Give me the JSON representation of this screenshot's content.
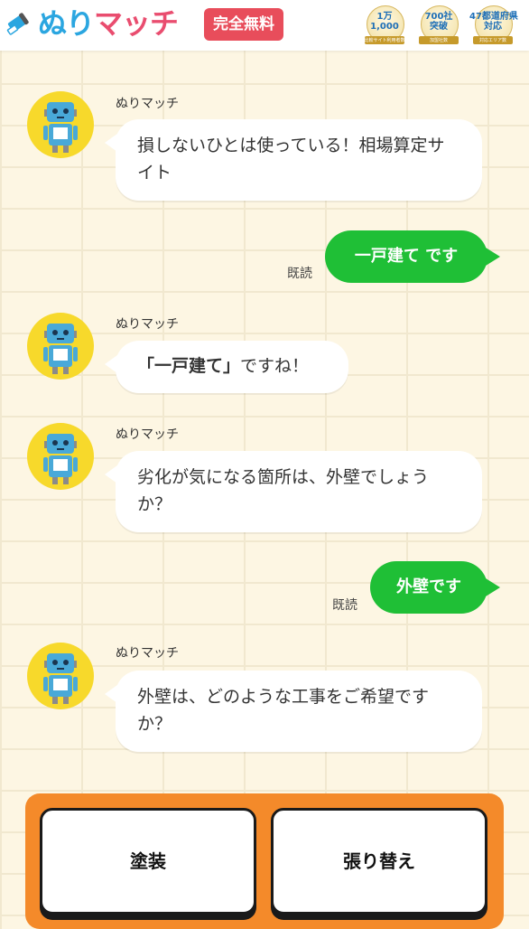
{
  "header": {
    "logo_main": "ぬり",
    "logo_accent": "マッチ",
    "free_badge": "完全無料",
    "awards": [
      {
        "main": "1万\n1,000",
        "sub": "比較サイト利用者数"
      },
      {
        "main": "700社\n突破",
        "sub": "加盟社数"
      },
      {
        "main": "47都道府県\n対応",
        "sub": "対応エリア数"
      }
    ]
  },
  "chat": {
    "bot_name": "ぬりマッチ",
    "read_label": "既読",
    "messages": [
      {
        "from": "bot",
        "text": "損しないひとは使っている！相場算定サイト"
      },
      {
        "from": "user",
        "text": "一戸建て です"
      },
      {
        "from": "bot",
        "text_quote": "「一戸建て」",
        "text_rest": "ですね！"
      },
      {
        "from": "bot",
        "text": "劣化が気になる箇所は、外壁でしょうか？"
      },
      {
        "from": "user",
        "text": "外壁です"
      },
      {
        "from": "bot",
        "text": "外壁は、どのような工事をご希望ですか？"
      }
    ]
  },
  "choices": [
    {
      "label": "塗装"
    },
    {
      "label": "張り替え"
    }
  ],
  "colors": {
    "accent_blue": "#2ba6e0",
    "accent_pink": "#e94d6f",
    "free_badge": "#e84d5b",
    "user_bubble": "#1fbf36",
    "choice_panel": "#f48a2a",
    "avatar_bg": "#f7d92b"
  }
}
